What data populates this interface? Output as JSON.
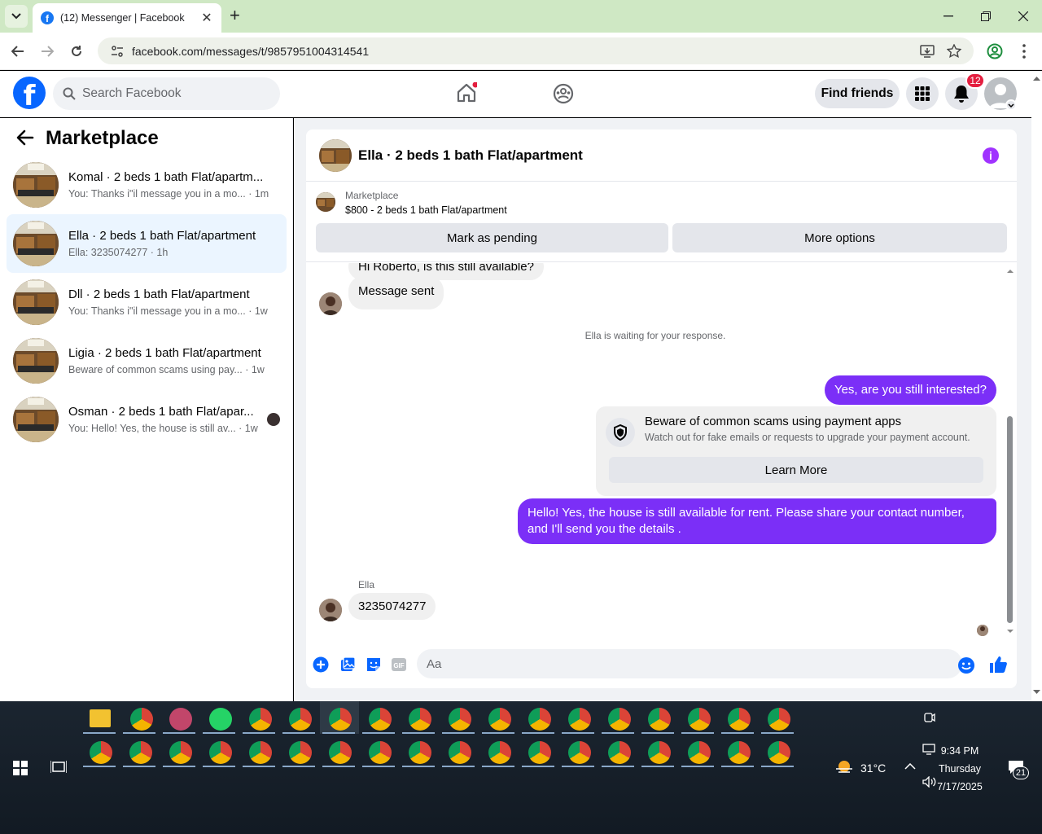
{
  "browser": {
    "tab_title": "(12) Messenger | Facebook",
    "url": "facebook.com/messages/t/9857951004314541"
  },
  "fb_header": {
    "search_placeholder": "Search Facebook",
    "find_friends": "Find friends",
    "notification_count": "12"
  },
  "left": {
    "title": "Marketplace",
    "conversations": [
      {
        "name": "Komal · 2 beds 1 bath Flat/apartm...",
        "preview": "You: Thanks i\"il message you in a mo... · 1m",
        "active": false
      },
      {
        "name": "Ella · 2 beds 1 bath Flat/apartment",
        "preview": "Ella: 3235074277 · 1h",
        "active": true
      },
      {
        "name": "Dll · 2 beds 1 bath Flat/apartment",
        "preview": "You: Thanks i\"il message you in a mo... · 1w",
        "active": false
      },
      {
        "name": "Ligia · 2 beds 1 bath Flat/apartment",
        "preview": "Beware of common scams using pay... · 1w",
        "active": false
      },
      {
        "name": "Osman · 2 beds 1 bath Flat/apar...",
        "preview": "You: Hello! Yes, the house is still av... · 1w",
        "active": false
      }
    ]
  },
  "chat": {
    "title": "Ella · 2 beds 1 bath Flat/apartment",
    "marketplace_label": "Marketplace",
    "listing": "$800 - 2 beds 1 bath Flat/apartment",
    "mark_pending": "Mark as pending",
    "more_options": "More options",
    "msg_cutoff": "Hi Roberto, is this still available?",
    "msg_sent": "Message sent",
    "waiting_note": "Ella is waiting for your response.",
    "msg_out_1": "Yes, are you still interested?",
    "scam_title": "Beware of common scams using payment apps",
    "scam_body": "Watch out for fake emails or requests to upgrade your payment account.",
    "learn_more": "Learn More",
    "msg_out_2": "Hello! Yes, the house is still available for rent. Please share your contact number, and I'll send you the details .",
    "sender_name": "Ella",
    "msg_in_number": "3235074277",
    "composer_placeholder": "Aa"
  },
  "taskbar": {
    "weather": "31°C",
    "time": "9:34 PM",
    "day": "Thursday",
    "date": "7/17/2025",
    "notif_count": "21"
  },
  "colors": {
    "fb_blue": "#0866ff",
    "messenger_purple": "#7b2ff7",
    "active_row": "#ebf5ff"
  }
}
